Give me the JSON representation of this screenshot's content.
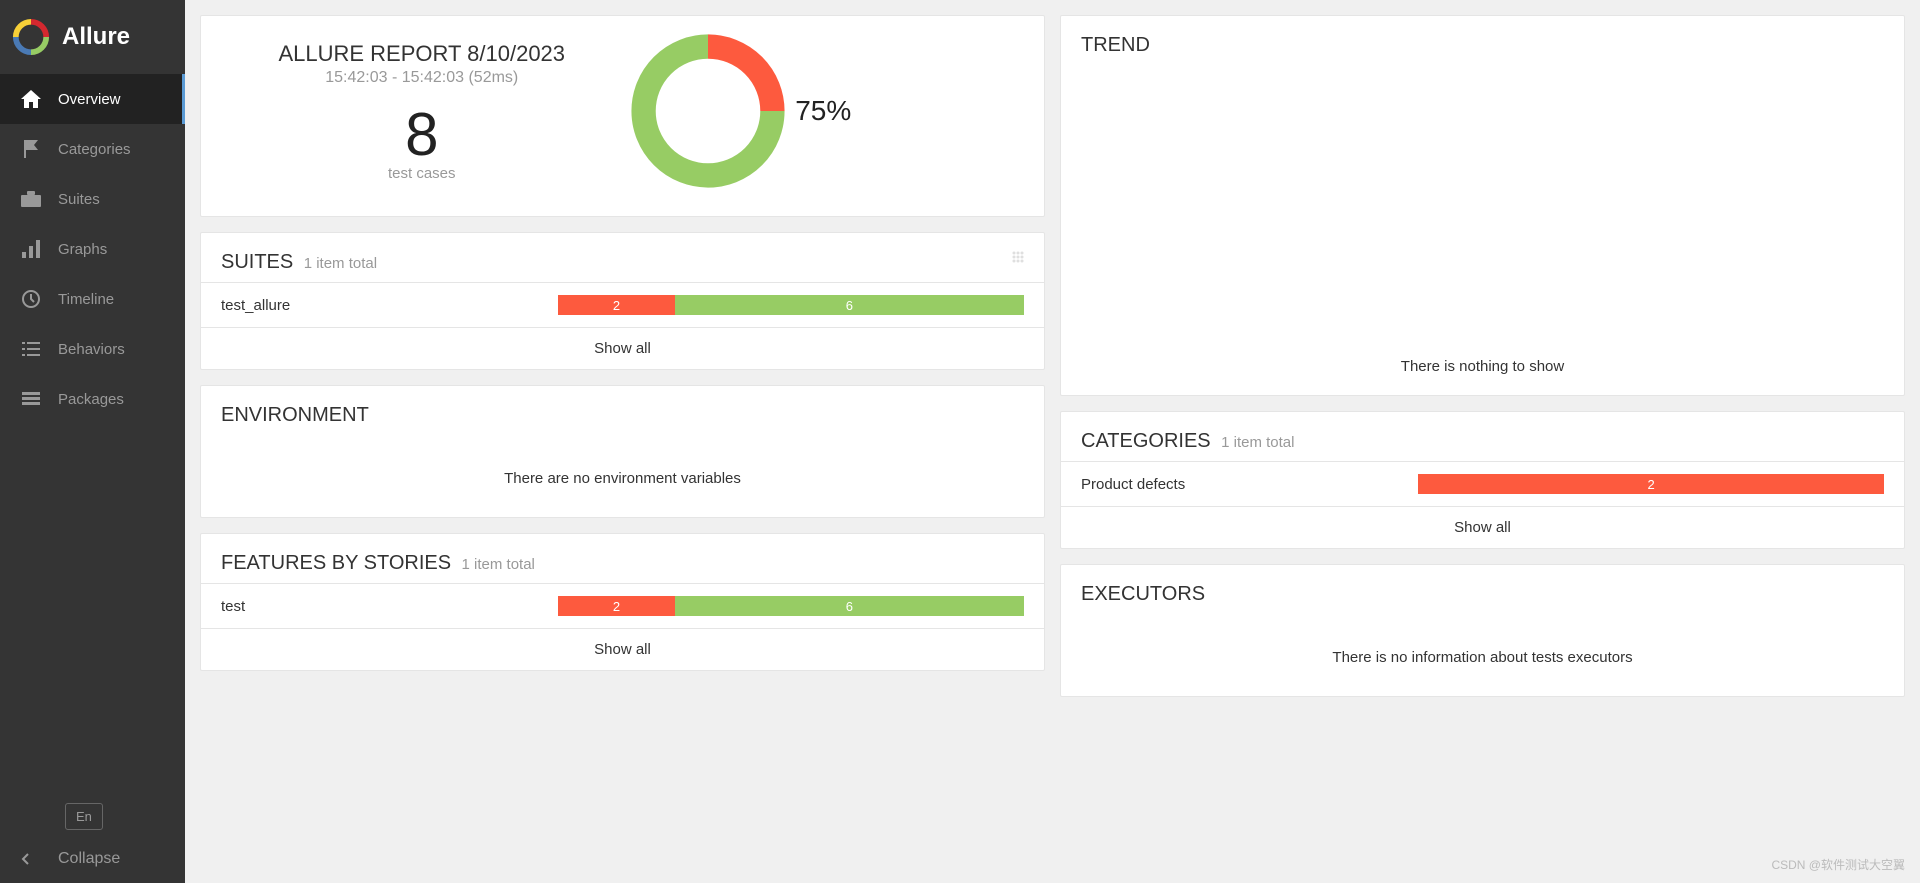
{
  "app": {
    "name": "Allure"
  },
  "sidebar": {
    "items": [
      {
        "label": "Overview",
        "icon": "home",
        "active": true
      },
      {
        "label": "Categories",
        "icon": "flag",
        "active": false
      },
      {
        "label": "Suites",
        "icon": "briefcase",
        "active": false
      },
      {
        "label": "Graphs",
        "icon": "chart",
        "active": false
      },
      {
        "label": "Timeline",
        "icon": "clock",
        "active": false
      },
      {
        "label": "Behaviors",
        "icon": "list",
        "active": false
      },
      {
        "label": "Packages",
        "icon": "layers",
        "active": false
      }
    ],
    "language": "En",
    "collapse": "Collapse"
  },
  "summary": {
    "title": "ALLURE REPORT 8/10/2023",
    "time": "15:42:03 - 15:42:03 (52ms)",
    "count": "8",
    "count_label": "test cases",
    "percent": "75%"
  },
  "suites": {
    "title": "SUITES",
    "subtitle": "1 item total",
    "items": [
      {
        "label": "test_allure",
        "failed": "2",
        "passed": "6"
      }
    ],
    "show_all": "Show all"
  },
  "environment": {
    "title": "ENVIRONMENT",
    "empty": "There are no environment variables"
  },
  "features": {
    "title": "FEATURES BY STORIES",
    "subtitle": "1 item total",
    "items": [
      {
        "label": "test",
        "failed": "2",
        "passed": "6"
      }
    ],
    "show_all": "Show all"
  },
  "trend": {
    "title": "TREND",
    "empty": "There is nothing to show"
  },
  "categories": {
    "title": "CATEGORIES",
    "subtitle": "1 item total",
    "items": [
      {
        "label": "Product defects",
        "failed": "2"
      }
    ],
    "show_all": "Show all"
  },
  "executors": {
    "title": "EXECUTORS",
    "empty": "There is no information about tests executors"
  },
  "watermark": "CSDN @软件测试大空翼",
  "chart_data": {
    "type": "pie",
    "title": "Test result ratio",
    "series": [
      {
        "name": "failed",
        "value": 2,
        "color": "#fd5a3e"
      },
      {
        "name": "passed",
        "value": 6,
        "color": "#97cc64"
      }
    ],
    "center_label": "75%"
  }
}
